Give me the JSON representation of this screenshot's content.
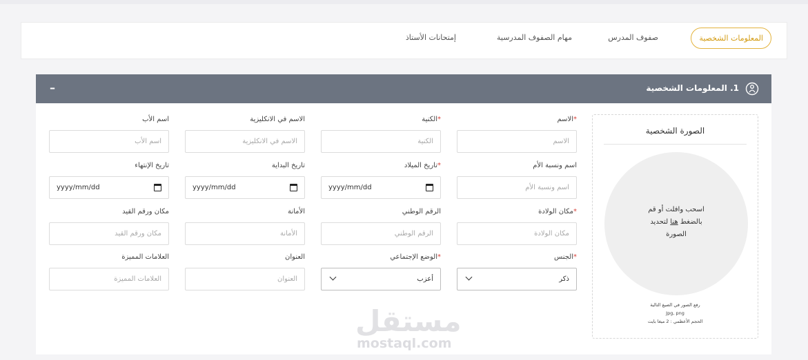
{
  "tabs": [
    {
      "label": "المعلومات الشخصية",
      "active": true
    },
    {
      "label": "صفوف المدرس",
      "active": false
    },
    {
      "label": "مهام الصفوف المدرسية",
      "active": false
    },
    {
      "label": "إمتحانات الأستاذ",
      "active": false
    }
  ],
  "panel": {
    "title": "1. المعلومات الشخصية",
    "collapse_symbol": "–"
  },
  "photo": {
    "title": "الصورة الشخصية",
    "drop_line1": "اسحب وافلت أو قم",
    "drop_line2_pre": "بالضغط ",
    "drop_link": "هنا",
    "drop_line2_post": " لتحديد",
    "drop_line3": "الصورة",
    "formats_label": "رفع الصور في الصيغ التالية",
    "formats": "Jpg, png",
    "max_size": "الحجم الأعظمي : 2 ميغا بايت"
  },
  "fields": {
    "name": {
      "label": "الاسم",
      "required": "*",
      "placeholder": "الاسم"
    },
    "surname": {
      "label": "الكنية",
      "required": "*",
      "placeholder": "الكنية"
    },
    "english_name": {
      "label": "الاسم في الانكليزية",
      "placeholder": "الاسم في الانكليزية"
    },
    "father_name": {
      "label": "اسم الأب",
      "placeholder": "اسم الأب"
    },
    "mother_name": {
      "label": "اسم ونسبة الأم",
      "placeholder": "اسم ونسبة الأم"
    },
    "birth_date": {
      "label": "تاريخ الميلاد",
      "required": "*",
      "value": "yyyy/mm/dd"
    },
    "start_date": {
      "label": "تاريخ البداية",
      "value": "yyyy/mm/dd"
    },
    "end_date": {
      "label": "تاريخ الإنتهاء",
      "value": "yyyy/mm/dd"
    },
    "birth_place": {
      "label": "مكان الولادة",
      "required": "*",
      "placeholder": "مكان الولادة"
    },
    "national_id": {
      "label": "الرقم الوطني",
      "placeholder": "الرقم الوطني"
    },
    "amana": {
      "label": "الأمانة",
      "placeholder": "الأمانة"
    },
    "registry": {
      "label": "مكان ورقم القيد",
      "placeholder": "مكان ورقم القيد"
    },
    "gender": {
      "label": "الجنس",
      "required": "*",
      "value": "ذكر"
    },
    "social_status": {
      "label": "الوضع الإجتماعي",
      "required": "*",
      "value": "أعزب"
    },
    "address": {
      "label": "العنوان",
      "placeholder": "العنوان"
    },
    "marks": {
      "label": "العلامات المميزة",
      "placeholder": "العلامات المميزة"
    }
  },
  "watermark": {
    "arabic": "مستقل",
    "latin": "mostaql.com"
  },
  "colors": {
    "accent": "#e3b23c",
    "header": "#6c7481",
    "required": "#d8433b"
  }
}
